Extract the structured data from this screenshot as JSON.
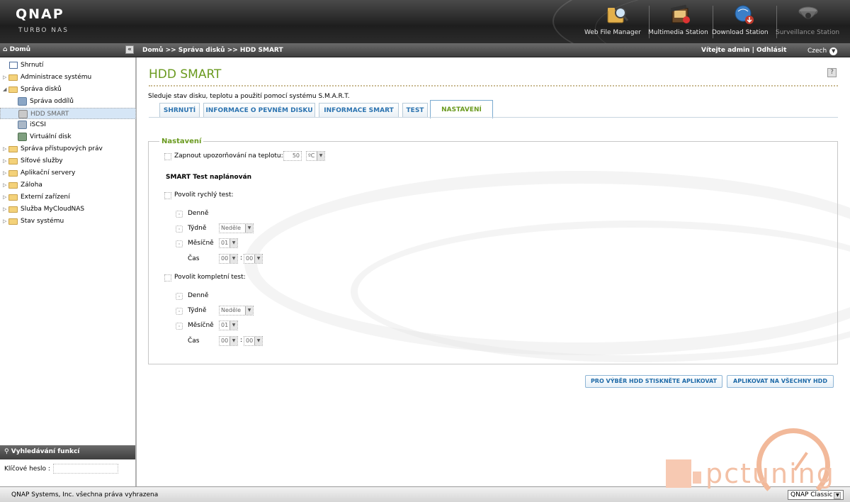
{
  "header": {
    "logo": "QNAP",
    "tagline": "TURBO NAS",
    "apps": [
      {
        "label": "Web File Manager",
        "icon": "web-file-manager-icon"
      },
      {
        "label": "Multimedia Station",
        "icon": "multimedia-station-icon"
      },
      {
        "label": "Download Station",
        "icon": "download-station-icon"
      },
      {
        "label": "Surveillance Station",
        "icon": "surveillance-station-icon"
      }
    ]
  },
  "navbar": {
    "home": "Domů",
    "breadcrumb": "Domů >> Správa disků >> HDD SMART",
    "welcome": "Vítejte admin",
    "logout": "Odhlásit",
    "language": "Czech"
  },
  "sidebar": {
    "items": [
      {
        "label": "Shrnutí"
      },
      {
        "label": "Administrace systému"
      },
      {
        "label": "Správa disků"
      },
      {
        "label": "Správa oddílů"
      },
      {
        "label": "HDD SMART"
      },
      {
        "label": "iSCSI"
      },
      {
        "label": "Virtuální disk"
      },
      {
        "label": "Správa přístupových práv"
      },
      {
        "label": "Síťové služby"
      },
      {
        "label": "Aplikační servery"
      },
      {
        "label": "Záloha"
      },
      {
        "label": "Externí zařízení"
      },
      {
        "label": "Služba MyCloudNAS"
      },
      {
        "label": "Stav systému"
      }
    ],
    "search_title": "Vyhledávání funkcí",
    "search_label": "Klíčové heslo :"
  },
  "main": {
    "title": "HDD SMART",
    "description": "Sleduje stav disku, teplotu a použití pomocí systému S.M.A.R.T.",
    "tabs": [
      {
        "label": "SHRNUTÍ"
      },
      {
        "label": "INFORMACE O PEVNÉM DISKU"
      },
      {
        "label": "INFORMACE SMART"
      },
      {
        "label": "TEST"
      },
      {
        "label": "NASTAVENÍ"
      }
    ],
    "active_tab": "NASTAVENÍ",
    "settings": {
      "legend": "Nastavení",
      "temp_alert_label": "Zapnout upozorňování na teplotu:",
      "temp_value": "50",
      "temp_unit": "ºC",
      "smart_heading": "SMART Test naplánován",
      "quick_test_label": "Povolit rychlý test:",
      "full_test_label": "Povolit kompletní test:",
      "daily": "Denně",
      "weekly": "Týdně",
      "monthly": "Měsíčně",
      "time": "Čas",
      "weekday_value": "Neděle",
      "month_day_value": "01",
      "hour_value": "00",
      "minute_value": "00",
      "time_sep": ":"
    },
    "buttons": {
      "apply_selected": "PRO VÝBĚR HDD STISKNĚTE APLIKOVAT",
      "apply_all": "APLIKOVAT NA VŠECHNY HDD"
    }
  },
  "footer": {
    "copyright": "QNAP Systems, Inc. všechna práva vyhrazena",
    "theme": "QNAP Classic"
  },
  "watermark": {
    "text": "pctuning"
  },
  "colors": {
    "accent_green": "#6a9a1f",
    "tab_blue": "#2b73b0",
    "header_dark": "#2b2b2b"
  }
}
